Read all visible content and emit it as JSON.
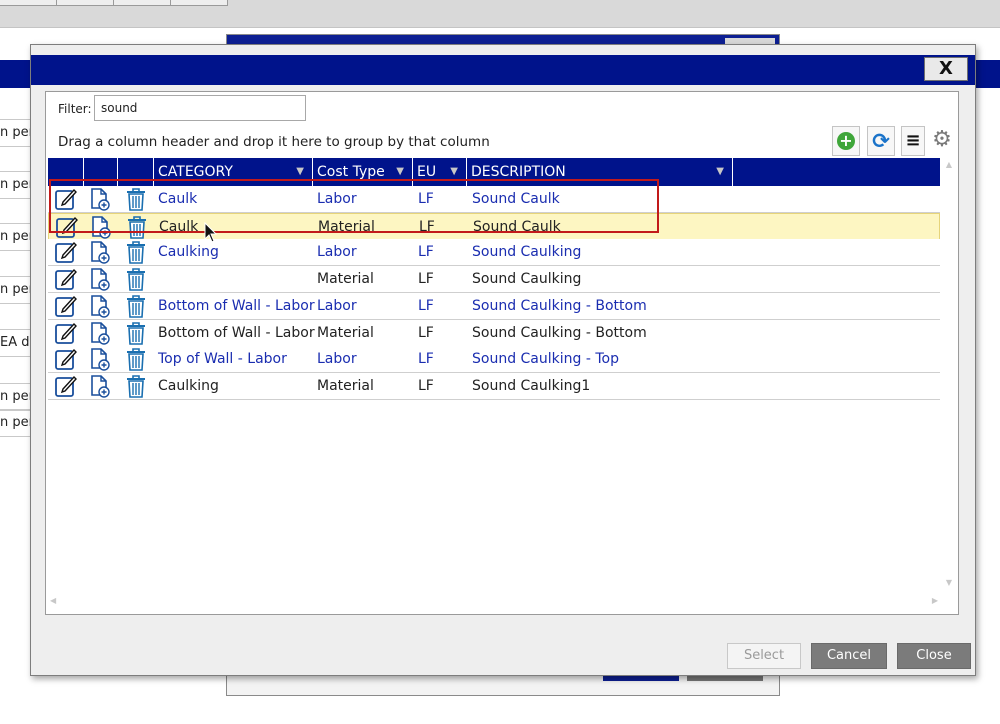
{
  "background": {
    "left_cells": [
      "n per",
      "n per",
      "n per",
      "n per",
      "EA d",
      "n per",
      "n per"
    ]
  },
  "modal": {
    "close_label": "X",
    "filter_label": "Filter:",
    "filter_value": "sound",
    "group_hint": "Drag a column header and drop it here to group by that column",
    "toolbar": {
      "add_icon": "add-circle-icon",
      "refresh_icon": "refresh-icon",
      "menu_icon": "menu-icon",
      "settings_icon": "gear-icon"
    },
    "columns": [
      "CATEGORY",
      "Cost Type",
      "EU",
      "DESCRIPTION"
    ],
    "rows": [
      {
        "category": "Caulk",
        "cost_type": "Labor",
        "eu": "LF",
        "description": "Sound Caulk",
        "style": "blue"
      },
      {
        "category": "Caulk",
        "cost_type": "Material",
        "eu": "LF",
        "description": "Sound Caulk",
        "style": "black",
        "selected": true
      },
      {
        "category": "Caulking",
        "cost_type": "Labor",
        "eu": "LF",
        "description": "Sound Caulking",
        "style": "blue"
      },
      {
        "category": "",
        "cost_type": "Material",
        "eu": "LF",
        "description": "Sound Caulking",
        "style": "black"
      },
      {
        "category": "Bottom of Wall - Labor",
        "cost_type": "Labor",
        "eu": "LF",
        "description": "Sound Caulking - Bottom",
        "style": "blue"
      },
      {
        "category": "Bottom of Wall - Labor",
        "cost_type": "Material",
        "eu": "LF",
        "description": "Sound Caulking - Bottom",
        "style": "black"
      },
      {
        "category": "Top of Wall - Labor",
        "cost_type": "Labor",
        "eu": "LF",
        "description": "Sound Caulking - Top",
        "style": "blue"
      },
      {
        "category": "Caulking",
        "cost_type": "Material",
        "eu": "LF",
        "description": "Sound Caulking1",
        "style": "black"
      }
    ],
    "row_icons": [
      "edit-icon",
      "new-document-icon",
      "trash-icon"
    ],
    "buttons": {
      "select": "Select",
      "cancel": "Cancel",
      "close": "Close"
    },
    "colors": {
      "header": "#00138b",
      "link_blue": "#1a2db0",
      "selected_row": "#fdf6c2",
      "highlight_border": "#c21a1a"
    }
  }
}
